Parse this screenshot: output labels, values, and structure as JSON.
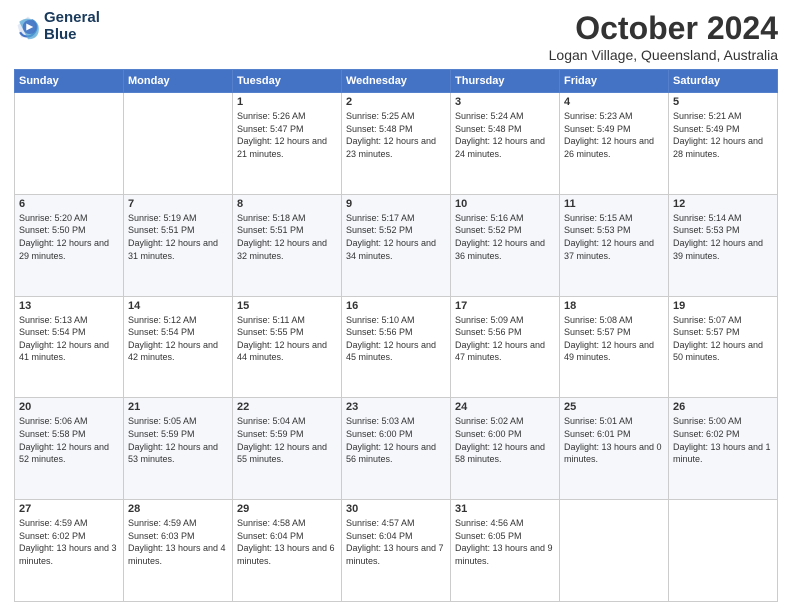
{
  "header": {
    "logo_line1": "General",
    "logo_line2": "Blue",
    "month": "October 2024",
    "location": "Logan Village, Queensland, Australia"
  },
  "weekdays": [
    "Sunday",
    "Monday",
    "Tuesday",
    "Wednesday",
    "Thursday",
    "Friday",
    "Saturday"
  ],
  "weeks": [
    [
      {
        "day": "",
        "sunrise": "",
        "sunset": "",
        "daylight": ""
      },
      {
        "day": "",
        "sunrise": "",
        "sunset": "",
        "daylight": ""
      },
      {
        "day": "1",
        "sunrise": "Sunrise: 5:26 AM",
        "sunset": "Sunset: 5:47 PM",
        "daylight": "Daylight: 12 hours and 21 minutes."
      },
      {
        "day": "2",
        "sunrise": "Sunrise: 5:25 AM",
        "sunset": "Sunset: 5:48 PM",
        "daylight": "Daylight: 12 hours and 23 minutes."
      },
      {
        "day": "3",
        "sunrise": "Sunrise: 5:24 AM",
        "sunset": "Sunset: 5:48 PM",
        "daylight": "Daylight: 12 hours and 24 minutes."
      },
      {
        "day": "4",
        "sunrise": "Sunrise: 5:23 AM",
        "sunset": "Sunset: 5:49 PM",
        "daylight": "Daylight: 12 hours and 26 minutes."
      },
      {
        "day": "5",
        "sunrise": "Sunrise: 5:21 AM",
        "sunset": "Sunset: 5:49 PM",
        "daylight": "Daylight: 12 hours and 28 minutes."
      }
    ],
    [
      {
        "day": "6",
        "sunrise": "Sunrise: 5:20 AM",
        "sunset": "Sunset: 5:50 PM",
        "daylight": "Daylight: 12 hours and 29 minutes."
      },
      {
        "day": "7",
        "sunrise": "Sunrise: 5:19 AM",
        "sunset": "Sunset: 5:51 PM",
        "daylight": "Daylight: 12 hours and 31 minutes."
      },
      {
        "day": "8",
        "sunrise": "Sunrise: 5:18 AM",
        "sunset": "Sunset: 5:51 PM",
        "daylight": "Daylight: 12 hours and 32 minutes."
      },
      {
        "day": "9",
        "sunrise": "Sunrise: 5:17 AM",
        "sunset": "Sunset: 5:52 PM",
        "daylight": "Daylight: 12 hours and 34 minutes."
      },
      {
        "day": "10",
        "sunrise": "Sunrise: 5:16 AM",
        "sunset": "Sunset: 5:52 PM",
        "daylight": "Daylight: 12 hours and 36 minutes."
      },
      {
        "day": "11",
        "sunrise": "Sunrise: 5:15 AM",
        "sunset": "Sunset: 5:53 PM",
        "daylight": "Daylight: 12 hours and 37 minutes."
      },
      {
        "day": "12",
        "sunrise": "Sunrise: 5:14 AM",
        "sunset": "Sunset: 5:53 PM",
        "daylight": "Daylight: 12 hours and 39 minutes."
      }
    ],
    [
      {
        "day": "13",
        "sunrise": "Sunrise: 5:13 AM",
        "sunset": "Sunset: 5:54 PM",
        "daylight": "Daylight: 12 hours and 41 minutes."
      },
      {
        "day": "14",
        "sunrise": "Sunrise: 5:12 AM",
        "sunset": "Sunset: 5:54 PM",
        "daylight": "Daylight: 12 hours and 42 minutes."
      },
      {
        "day": "15",
        "sunrise": "Sunrise: 5:11 AM",
        "sunset": "Sunset: 5:55 PM",
        "daylight": "Daylight: 12 hours and 44 minutes."
      },
      {
        "day": "16",
        "sunrise": "Sunrise: 5:10 AM",
        "sunset": "Sunset: 5:56 PM",
        "daylight": "Daylight: 12 hours and 45 minutes."
      },
      {
        "day": "17",
        "sunrise": "Sunrise: 5:09 AM",
        "sunset": "Sunset: 5:56 PM",
        "daylight": "Daylight: 12 hours and 47 minutes."
      },
      {
        "day": "18",
        "sunrise": "Sunrise: 5:08 AM",
        "sunset": "Sunset: 5:57 PM",
        "daylight": "Daylight: 12 hours and 49 minutes."
      },
      {
        "day": "19",
        "sunrise": "Sunrise: 5:07 AM",
        "sunset": "Sunset: 5:57 PM",
        "daylight": "Daylight: 12 hours and 50 minutes."
      }
    ],
    [
      {
        "day": "20",
        "sunrise": "Sunrise: 5:06 AM",
        "sunset": "Sunset: 5:58 PM",
        "daylight": "Daylight: 12 hours and 52 minutes."
      },
      {
        "day": "21",
        "sunrise": "Sunrise: 5:05 AM",
        "sunset": "Sunset: 5:59 PM",
        "daylight": "Daylight: 12 hours and 53 minutes."
      },
      {
        "day": "22",
        "sunrise": "Sunrise: 5:04 AM",
        "sunset": "Sunset: 5:59 PM",
        "daylight": "Daylight: 12 hours and 55 minutes."
      },
      {
        "day": "23",
        "sunrise": "Sunrise: 5:03 AM",
        "sunset": "Sunset: 6:00 PM",
        "daylight": "Daylight: 12 hours and 56 minutes."
      },
      {
        "day": "24",
        "sunrise": "Sunrise: 5:02 AM",
        "sunset": "Sunset: 6:00 PM",
        "daylight": "Daylight: 12 hours and 58 minutes."
      },
      {
        "day": "25",
        "sunrise": "Sunrise: 5:01 AM",
        "sunset": "Sunset: 6:01 PM",
        "daylight": "Daylight: 13 hours and 0 minutes."
      },
      {
        "day": "26",
        "sunrise": "Sunrise: 5:00 AM",
        "sunset": "Sunset: 6:02 PM",
        "daylight": "Daylight: 13 hours and 1 minute."
      }
    ],
    [
      {
        "day": "27",
        "sunrise": "Sunrise: 4:59 AM",
        "sunset": "Sunset: 6:02 PM",
        "daylight": "Daylight: 13 hours and 3 minutes."
      },
      {
        "day": "28",
        "sunrise": "Sunrise: 4:59 AM",
        "sunset": "Sunset: 6:03 PM",
        "daylight": "Daylight: 13 hours and 4 minutes."
      },
      {
        "day": "29",
        "sunrise": "Sunrise: 4:58 AM",
        "sunset": "Sunset: 6:04 PM",
        "daylight": "Daylight: 13 hours and 6 minutes."
      },
      {
        "day": "30",
        "sunrise": "Sunrise: 4:57 AM",
        "sunset": "Sunset: 6:04 PM",
        "daylight": "Daylight: 13 hours and 7 minutes."
      },
      {
        "day": "31",
        "sunrise": "Sunrise: 4:56 AM",
        "sunset": "Sunset: 6:05 PM",
        "daylight": "Daylight: 13 hours and 9 minutes."
      },
      {
        "day": "",
        "sunrise": "",
        "sunset": "",
        "daylight": ""
      },
      {
        "day": "",
        "sunrise": "",
        "sunset": "",
        "daylight": ""
      }
    ]
  ]
}
